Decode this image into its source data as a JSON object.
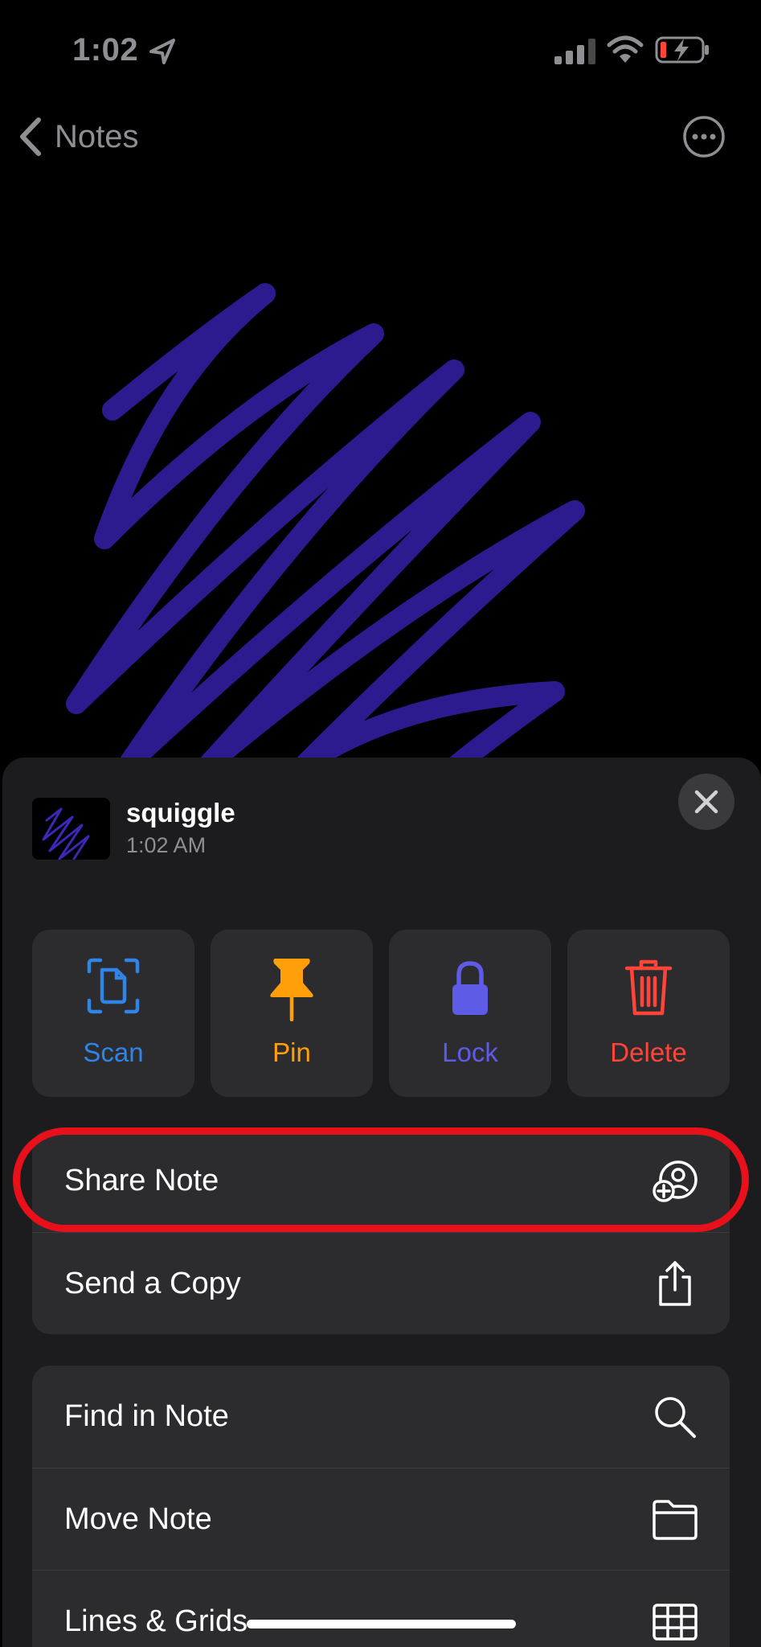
{
  "status_bar": {
    "time": "1:02"
  },
  "nav": {
    "back_label": "Notes"
  },
  "note": {
    "title": "squiggle",
    "time": "1:02 AM"
  },
  "actions": [
    {
      "label": "Scan",
      "icon": "scan-document-icon",
      "color": "#2f84e8"
    },
    {
      "label": "Pin",
      "icon": "pin-icon",
      "color": "#ff9f0a"
    },
    {
      "label": "Lock",
      "icon": "lock-icon",
      "color": "#5e5ce6"
    },
    {
      "label": "Delete",
      "icon": "trash-icon",
      "color": "#ff453a"
    }
  ],
  "share_group": [
    {
      "label": "Share Note",
      "icon": "share-person-add-icon"
    },
    {
      "label": "Send a Copy",
      "icon": "share-upload-icon"
    }
  ],
  "tools_group": [
    {
      "label": "Find in Note",
      "icon": "magnifier-icon"
    },
    {
      "label": "Move Note",
      "icon": "folder-icon"
    },
    {
      "label": "Lines & Grids",
      "icon": "grid-icon"
    }
  ],
  "colors": {
    "drawing_stroke": "#2b1b8f",
    "highlight": "#e8101a",
    "sheet_bg": "#1c1c1e",
    "tile_bg": "#2c2c2e"
  }
}
